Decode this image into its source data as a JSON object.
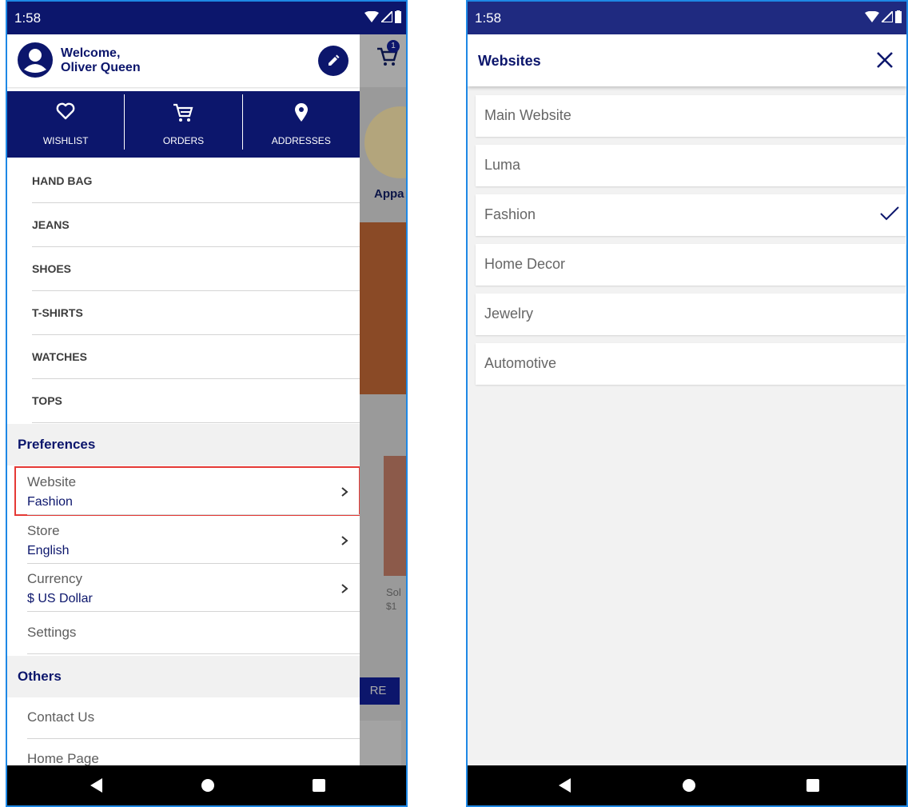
{
  "status": {
    "time": "1:58"
  },
  "left": {
    "header": {
      "welcome_line1": "Welcome,",
      "welcome_line2": "Oliver Queen"
    },
    "quick_actions": [
      {
        "label": "WISHLIST",
        "icon": "heart-icon"
      },
      {
        "label": "ORDERS",
        "icon": "cart-icon"
      },
      {
        "label": "ADDRESSES",
        "icon": "location-pin-icon"
      }
    ],
    "categories": [
      "HAND BAG",
      "JEANS",
      "SHOES",
      "T-SHIRTS",
      "WATCHES",
      "TOPS"
    ],
    "preferences": {
      "title": "Preferences",
      "items": [
        {
          "title": "Website",
          "value": "Fashion"
        },
        {
          "title": "Store",
          "value": "English"
        },
        {
          "title": "Currency",
          "value": "$ US Dollar"
        }
      ],
      "settings": "Settings"
    },
    "others": {
      "title": "Others",
      "items": [
        "Contact Us",
        "Home Page"
      ]
    },
    "background_app": {
      "cart_badge": "1",
      "category_label": "Appa",
      "product_name": "Sol",
      "product_price": "$1",
      "button_label": "RE"
    }
  },
  "right": {
    "title": "Websites",
    "sites": [
      {
        "name": "Main Website",
        "selected": false
      },
      {
        "name": "Luma",
        "selected": false
      },
      {
        "name": "Fashion",
        "selected": true
      },
      {
        "name": "Home Decor",
        "selected": false
      },
      {
        "name": "Jewelry",
        "selected": false
      },
      {
        "name": "Automotive",
        "selected": false
      }
    ]
  },
  "colors": {
    "primary": "#0c166c",
    "highlight": "#e53935"
  }
}
